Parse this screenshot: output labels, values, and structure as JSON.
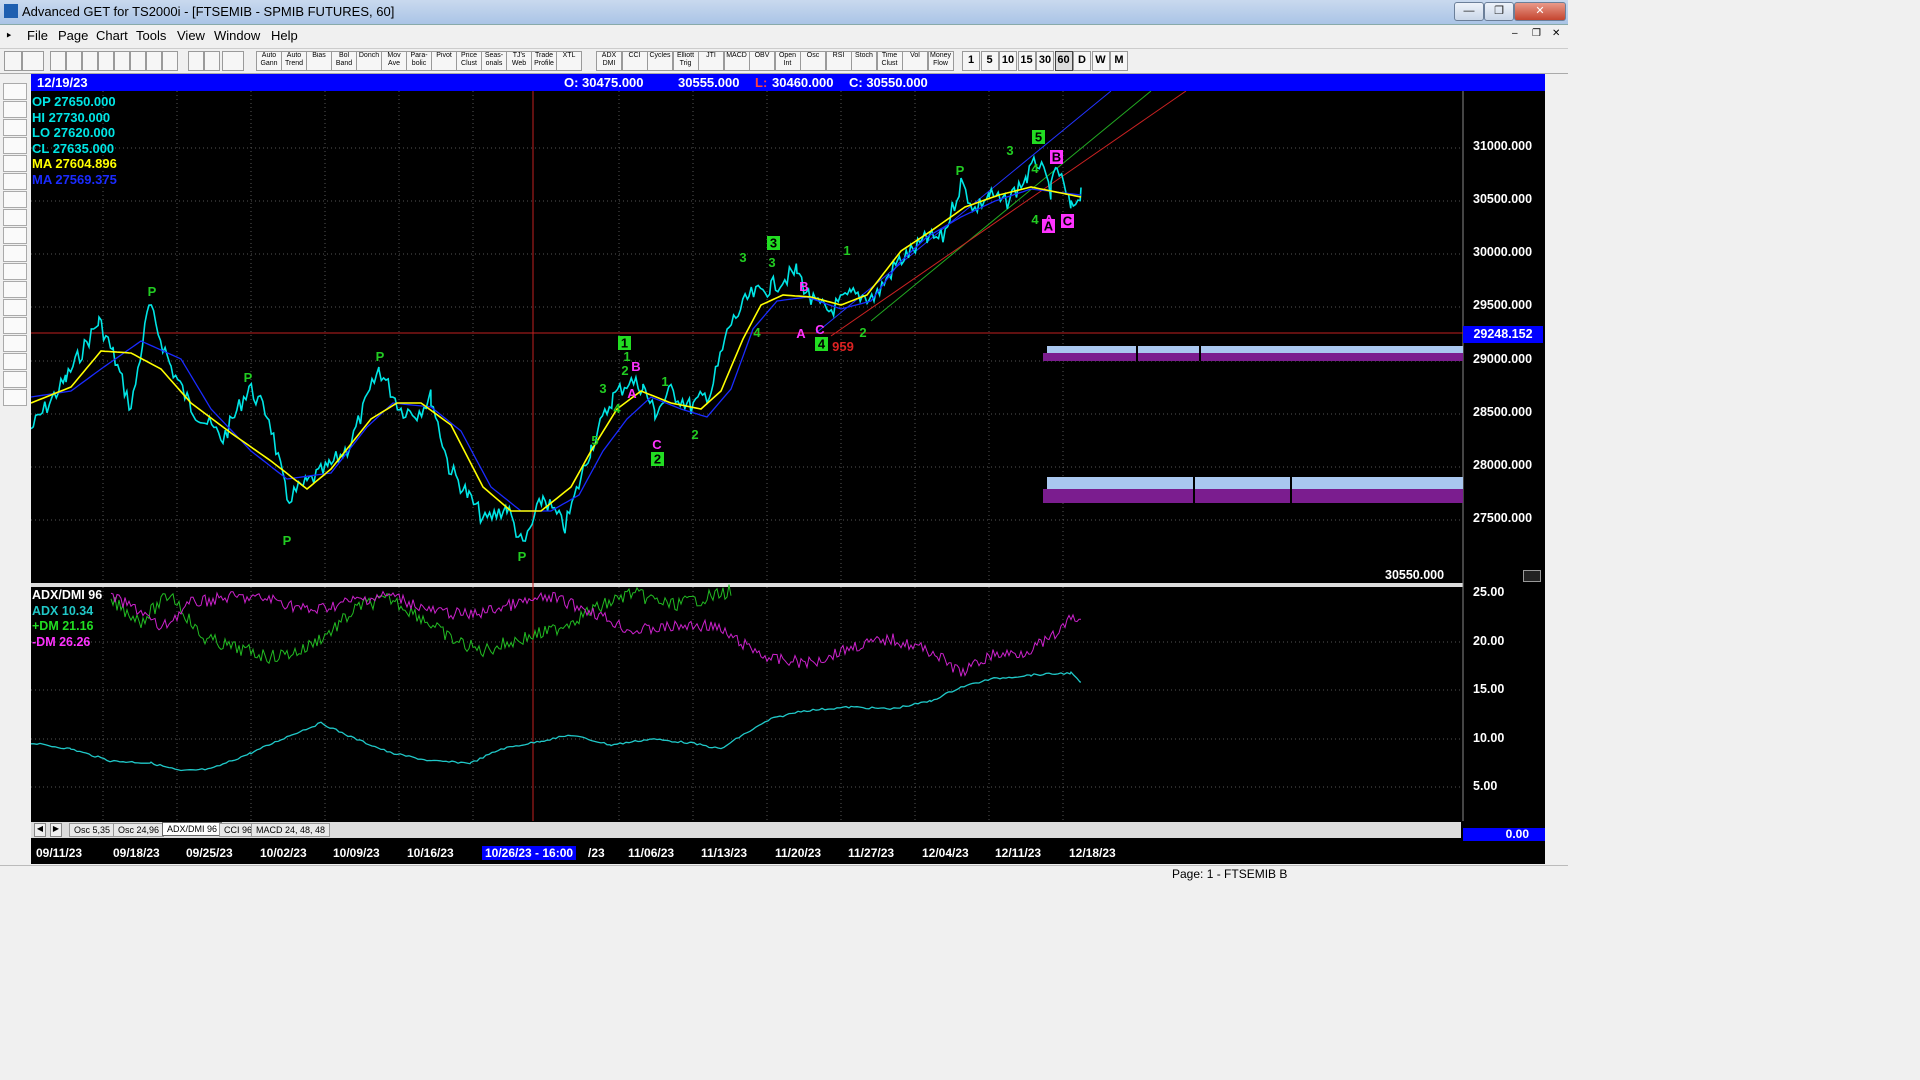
{
  "window": {
    "title": "Advanced GET for TS2000i - [FTSEMIB - SPMIB FUTURES, 60]"
  },
  "menu": [
    "File",
    "Page",
    "Chart",
    "Tools",
    "View",
    "Window",
    "Help"
  ],
  "toolbar": {
    "studies": [
      "Auto Gann",
      "Auto Trend",
      "Bias",
      "Bol Band",
      "Donch",
      "Mov Ave",
      "Para-bolic",
      "Pivot",
      "Price Clust",
      "Seas-onals",
      "TJ's Web",
      "Trade Profile",
      "XTL"
    ],
    "indicators": [
      "ADX DMI",
      "CCI",
      "Cycles",
      "Elliott Trig",
      "JTI",
      "MACD",
      "OBV",
      "Open Int",
      "Osc",
      "RSI",
      "Stoch",
      "Time Clust",
      "Vol",
      "Money Flow"
    ],
    "intervals": [
      "1",
      "5",
      "10",
      "15",
      "30",
      "60",
      "D",
      "W",
      "M"
    ]
  },
  "header_bar": {
    "date": "12/19/23",
    "open": "O: 30475.000",
    "high": "30555.000",
    "low_label": "L:",
    "low": "30460.000",
    "close": "C: 30550.000"
  },
  "info_panel": {
    "op": "OP  27650.000",
    "hi": "HI   27730.000",
    "lo": "LO  27620.000",
    "cl": "CL  27635.000",
    "ma1": "MA  27604.896",
    "ma2": "MA  27569.375"
  },
  "price_axis": [
    "31000.000",
    "30500.000",
    "30000.000",
    "29500.000",
    "29000.000",
    "28500.000",
    "28000.000",
    "27500.000"
  ],
  "current_price_label": "29248.152",
  "last_price": "30550.000",
  "indicator_panel": {
    "title": "ADX/DMI 96",
    "adx": "ADX 10.34",
    "plus_dm": "+DM 21.16",
    "minus_dm": "-DM  26.26",
    "axis": [
      "25.00",
      "20.00",
      "15.00",
      "10.00",
      "5.00",
      "0.00"
    ]
  },
  "tabs": [
    "Osc 5,35",
    "Osc 24,96",
    "ADX/DMI 96",
    "CCI 96",
    "MACD 24, 48, 48"
  ],
  "date_axis": [
    "09/11/23",
    "09/18/23",
    "09/25/23",
    "10/02/23",
    "10/09/23",
    "10/16/23",
    "10/26/23 - 16:00",
    "/23",
    "11/06/23",
    "11/13/23",
    "11/20/23",
    "11/27/23",
    "12/04/23",
    "12/11/23",
    "12/18/23"
  ],
  "elliott_labels": {
    "pivots": [
      "P",
      "P",
      "P",
      "P",
      "P",
      "P"
    ],
    "wave_numbers": [
      "1",
      "2",
      "3",
      "4",
      "5",
      "3",
      "4",
      "1",
      "2",
      "3",
      "4",
      "1",
      "2",
      "3",
      "4"
    ],
    "abc": [
      "A",
      "B",
      "C",
      "A",
      "B",
      "C",
      "A",
      "B",
      "C"
    ],
    "box_labels": [
      "1",
      "2",
      "3",
      "4",
      "5"
    ],
    "count_value": "959"
  },
  "status": {
    "text": "Page: 1 - FTSEMIB B"
  },
  "colors": {
    "header_blue": "#0000ff",
    "cyan": "#00e5e5",
    "yellow": "#ffff00",
    "green": "#22cc22",
    "magenta": "#ff00ff",
    "red": "#dd2222"
  }
}
